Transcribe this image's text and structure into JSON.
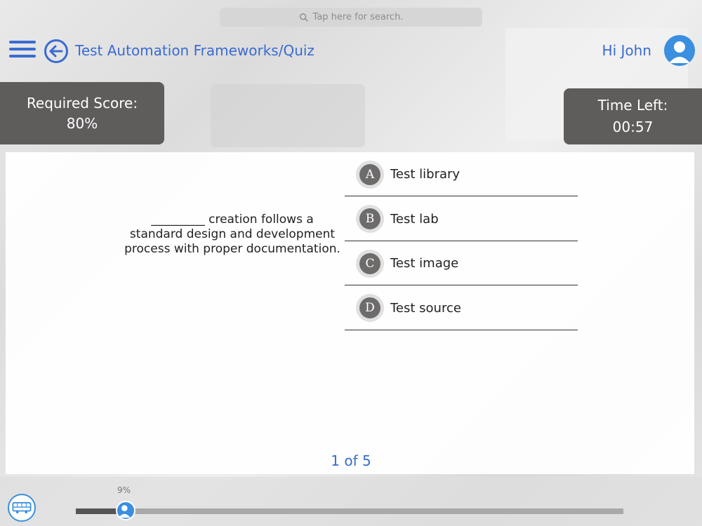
{
  "search": {
    "placeholder": "Tap here for search."
  },
  "header": {
    "title": "Test Automation Frameworks/Quiz",
    "greeting": "Hi John"
  },
  "score": {
    "label": "Required Score:",
    "value": "80%"
  },
  "timer": {
    "label": "Time Left:",
    "value": "00:57"
  },
  "question": {
    "text": "_________ creation follows a standard design and development process with proper documentation."
  },
  "options": [
    {
      "letter": "A",
      "label": "Test library"
    },
    {
      "letter": "B",
      "label": "Test lab"
    },
    {
      "letter": "C",
      "label": "Test image"
    },
    {
      "letter": "D",
      "label": "Test source"
    }
  ],
  "pager": {
    "text": "1 of 5"
  },
  "progress": {
    "label": "9%",
    "fraction": 0.09
  },
  "colors": {
    "accent": "#3a6bd1",
    "box": "#5f5c5c",
    "avatar": "#3a8fe0"
  }
}
